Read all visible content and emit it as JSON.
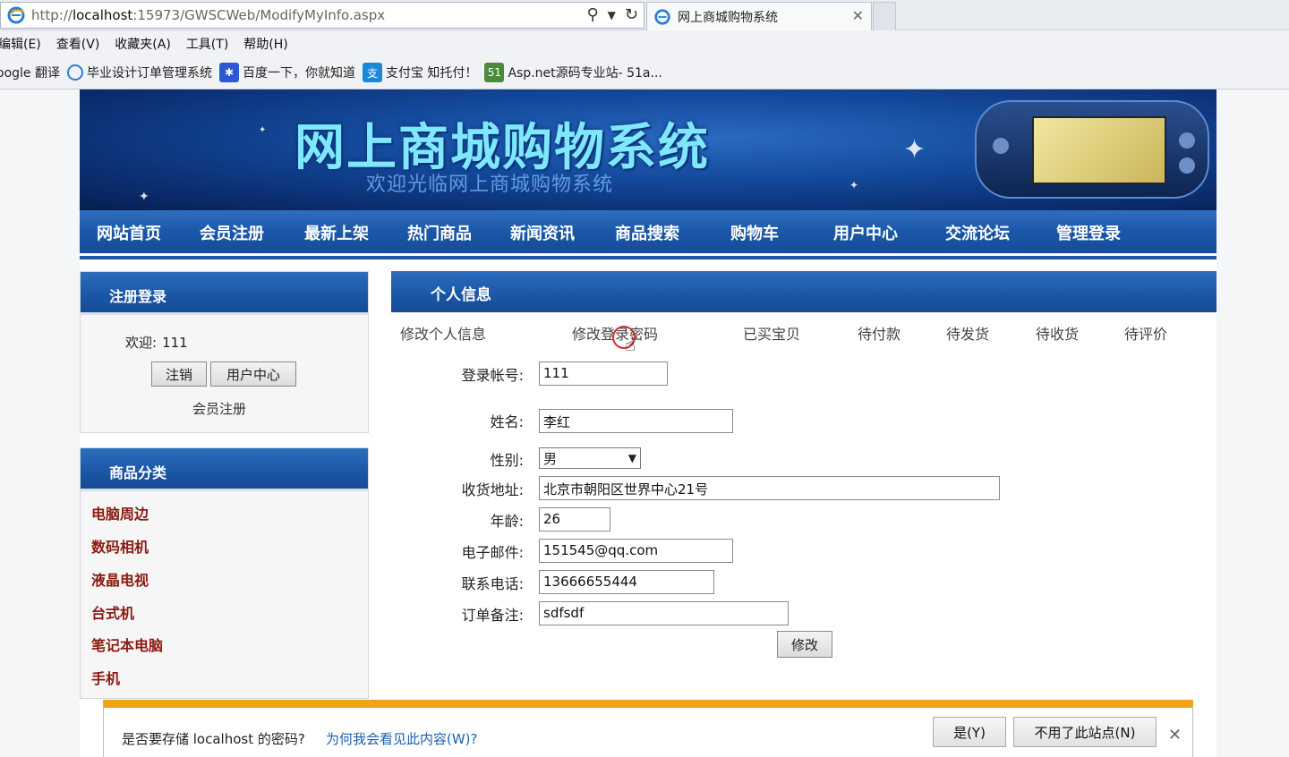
{
  "browser": {
    "url_prefix": "http://",
    "url_host": "localhost",
    "url_rest": ":15973/GWSCWeb/ModifyMyInfo.aspx",
    "tab_title": "网上商城购物系统",
    "menu": [
      "编辑(E)",
      "查看(V)",
      "收藏夹(A)",
      "工具(T)",
      "帮助(H)"
    ],
    "favorites": [
      "oogle 翻译",
      "毕业设计订单管理系统",
      "百度一下，你就知道",
      "支付宝 知托付！",
      "Asp.net源码专业站- 51a..."
    ]
  },
  "banner": {
    "title": "网上商城购物系统",
    "subtitle": "欢迎光临网上商城购物系统"
  },
  "nav": [
    "网站首页",
    "会员注册",
    "最新上架",
    "热门商品",
    "新闻资讯",
    "商品搜索",
    "购物车",
    "用户中心",
    "交流论坛",
    "管理登录"
  ],
  "login": {
    "header": "注册登录",
    "welcome_label": "欢迎:",
    "username": "111",
    "logout_label": "注销",
    "user_center_label": "用户中心",
    "register_label": "会员注册"
  },
  "categories": {
    "header": "商品分类",
    "items": [
      "电脑周边",
      "数码相机",
      "液晶电视",
      "台式机",
      "笔记本电脑",
      "手机"
    ]
  },
  "main": {
    "header": "个人信息",
    "subtabs": [
      "修改个人信息",
      "修改登录密码",
      "已买宝贝",
      "待付款",
      "待发货",
      "待收货",
      "待评价"
    ],
    "form": {
      "account_label": "登录帐号:",
      "account_value": "111",
      "name_label": "姓名:",
      "name_value": "李红",
      "gender_label": "性别:",
      "gender_value": "男",
      "address_label": "收货地址:",
      "address_value": "北京市朝阳区世界中心21号",
      "age_label": "年龄:",
      "age_value": "26",
      "email_label": "电子邮件:",
      "email_value": "151545@qq.com",
      "phone_label": "联系电话:",
      "phone_value": "13666655444",
      "note_label": "订单备注:",
      "note_value": "sdfsdf",
      "submit_label": "修改"
    }
  },
  "notification": {
    "question": "是否要存储 localhost 的密码?",
    "why_link": "为何我会看见此内容(W)?",
    "yes_label": "是(Y)",
    "never_label": "不用了此站点(N)"
  }
}
